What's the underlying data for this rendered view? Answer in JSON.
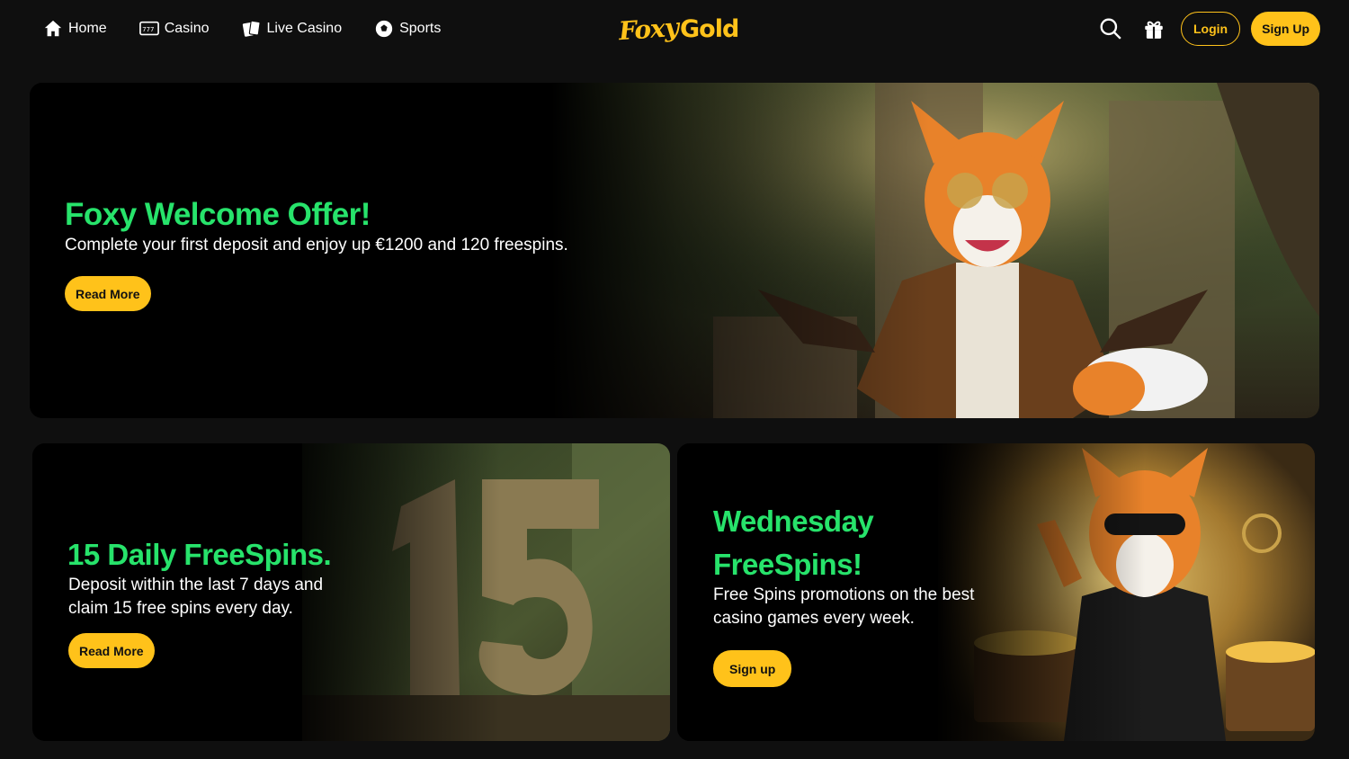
{
  "nav": {
    "home_label": "Home",
    "casino_label": "Casino",
    "live_casino_label": "Live Casino",
    "sports_label": "Sports"
  },
  "logo": {
    "foxy": "Foxy",
    "gold": "Gold"
  },
  "header": {
    "login_label": "Login",
    "signup_label": "Sign Up",
    "search_icon": "search-icon",
    "gift_icon": "gift-icon"
  },
  "hero": {
    "title": "Foxy Welcome Offer!",
    "text": "Complete your first deposit and enjoy up €1200 and 120 freespins.",
    "button": "Read More"
  },
  "promo_daily": {
    "title": "15 Daily FreeSpins.",
    "text_line1": "Deposit within the last 7 days and",
    "text_line2": "claim 15 free spins every day.",
    "button": "Read More"
  },
  "promo_wednesday": {
    "title_line1": "Wednesday",
    "title_line2": "FreeSpins!",
    "text_line1": "Free Spins promotions on the best",
    "text_line2": "casino games every week.",
    "button": "Sign up"
  },
  "colors": {
    "accent": "#ffc21a",
    "headline": "#27e36b",
    "background": "#0f0f0f"
  }
}
